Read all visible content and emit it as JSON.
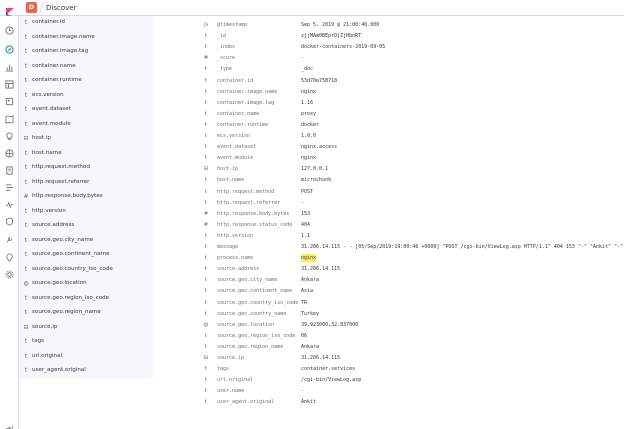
{
  "header": {
    "space_initial": "D",
    "app_title": "Discover"
  },
  "colors": {
    "space_badge": "#e7664c",
    "field_panel_bg": "#f5f7fa",
    "highlight": "#fff24d"
  },
  "nav_icons": [
    "clock-icon",
    "compass-icon",
    "visualize-icon",
    "dashboard-icon",
    "canvas-icon",
    "maps-icon",
    "ml-icon",
    "infrastructure-icon",
    "logs-icon",
    "apm-icon",
    "uptime-icon",
    "siem-icon",
    "dev-tools-icon",
    "monitoring-icon",
    "management-icon"
  ],
  "nav_bottom_icon": "collapse-menu-icon",
  "fields": [
    {
      "type": "t",
      "name": "container.id"
    },
    {
      "type": "t",
      "name": "container.image.name"
    },
    {
      "type": "t",
      "name": "container.image.tag"
    },
    {
      "type": "t",
      "name": "container.name"
    },
    {
      "type": "t",
      "name": "container.runtime"
    },
    {
      "type": "t",
      "name": "ecs.version"
    },
    {
      "type": "t",
      "name": "event.dataset"
    },
    {
      "type": "t",
      "name": "event.module"
    },
    {
      "type": "⊟",
      "name": "host.ip"
    },
    {
      "type": "t",
      "name": "host.name"
    },
    {
      "type": "t",
      "name": "http.request.method"
    },
    {
      "type": "t",
      "name": "http.request.referrer"
    },
    {
      "type": "#",
      "name": "http.response.body.bytes"
    },
    {
      "type": "t",
      "name": "http.version"
    },
    {
      "type": "t",
      "name": "source.address"
    },
    {
      "type": "t",
      "name": "source.geo.city_name"
    },
    {
      "type": "t",
      "name": "source.geo.continent_name"
    },
    {
      "type": "t",
      "name": "source.geo.country_iso_code"
    },
    {
      "type": "◍",
      "name": "source.geo.location"
    },
    {
      "type": "t",
      "name": "source.geo.region_iso_code"
    },
    {
      "type": "t",
      "name": "source.geo.region_name"
    },
    {
      "type": "⊟",
      "name": "source.ip"
    },
    {
      "type": "t",
      "name": "tags"
    },
    {
      "type": "t",
      "name": "url.original"
    },
    {
      "type": "t",
      "name": "user_agent.original"
    }
  ],
  "document": [
    {
      "icon": "◷",
      "name": "@timestamp",
      "value": "Sep 5, 2019 @ 21:00:46.000"
    },
    {
      "icon": "t",
      "name": "_id",
      "value": "zjjMAm0BEprDjZjHbnRT"
    },
    {
      "icon": "t",
      "name": "_index",
      "value": "docker-containers-2019-09-05"
    },
    {
      "icon": "#",
      "name": "_score",
      "value": "-"
    },
    {
      "icon": "t",
      "name": "_type",
      "value": "_doc"
    },
    {
      "icon": "t",
      "name": "container.id",
      "value": "53d70e75B718"
    },
    {
      "icon": "t",
      "name": "container.image.name",
      "value": "nginx"
    },
    {
      "icon": "t",
      "name": "container.image.tag",
      "value": "1.16"
    },
    {
      "icon": "t",
      "name": "container.name",
      "value": "proxy"
    },
    {
      "icon": "t",
      "name": "container.runtime",
      "value": "docker"
    },
    {
      "icon": "t",
      "name": "ecs.version",
      "value": "1.0.0"
    },
    {
      "icon": "t",
      "name": "event.dataset",
      "value": "nginx.access"
    },
    {
      "icon": "t",
      "name": "event.module",
      "value": "nginx"
    },
    {
      "icon": "⊟",
      "name": "host.ip",
      "value": "127.0.0.1"
    },
    {
      "icon": "t",
      "name": "host.name",
      "value": "microchunk"
    },
    {
      "icon": "t",
      "name": "http.request.method",
      "value": "POST"
    },
    {
      "icon": "t",
      "name": "http.request.referrer",
      "value": "-"
    },
    {
      "icon": "#",
      "name": "http.response.body.bytes",
      "value": "153"
    },
    {
      "icon": "#",
      "name": "http.response.status_code",
      "value": "404"
    },
    {
      "icon": "t",
      "name": "http.version",
      "value": "1.1"
    },
    {
      "icon": "t",
      "name": "message",
      "value": "31.206.14.115 - - [05/Sep/2019:19:00:46 +0000] \"POST /cgi-bin/ViewLog.asp HTTP/1.1\" 404 153 \"-\" \"Ankit\" \"-\""
    },
    {
      "icon": "t",
      "name": "process.name",
      "value": "nginx",
      "highlight": true
    },
    {
      "icon": "t",
      "name": "source.address",
      "value": "31.206.14.115"
    },
    {
      "icon": "t",
      "name": "source.geo.city_name",
      "value": "Ankara"
    },
    {
      "icon": "t",
      "name": "source.geo.continent_name",
      "value": "Asia"
    },
    {
      "icon": "t",
      "name": "source.geo.country_iso_code",
      "value": "TR"
    },
    {
      "icon": "t",
      "name": "source.geo.country_name",
      "value": "Turkey"
    },
    {
      "icon": "◍",
      "name": "source.geo.location",
      "value": "39.923000,32.837000"
    },
    {
      "icon": "t",
      "name": "source.geo.region_iso_code",
      "value": "06"
    },
    {
      "icon": "t",
      "name": "source.geo.region_name",
      "value": "Ankara"
    },
    {
      "icon": "⊟",
      "name": "source.ip",
      "value": "31.206.14.115"
    },
    {
      "icon": "t",
      "name": "tags",
      "value": "container-services"
    },
    {
      "icon": "t",
      "name": "url.original",
      "value": "/cgi-bin/ViewLog.asp"
    },
    {
      "icon": "t",
      "name": "user.name",
      "value": "-"
    },
    {
      "icon": "t",
      "name": "user_agent.original",
      "value": "Ankit"
    }
  ]
}
